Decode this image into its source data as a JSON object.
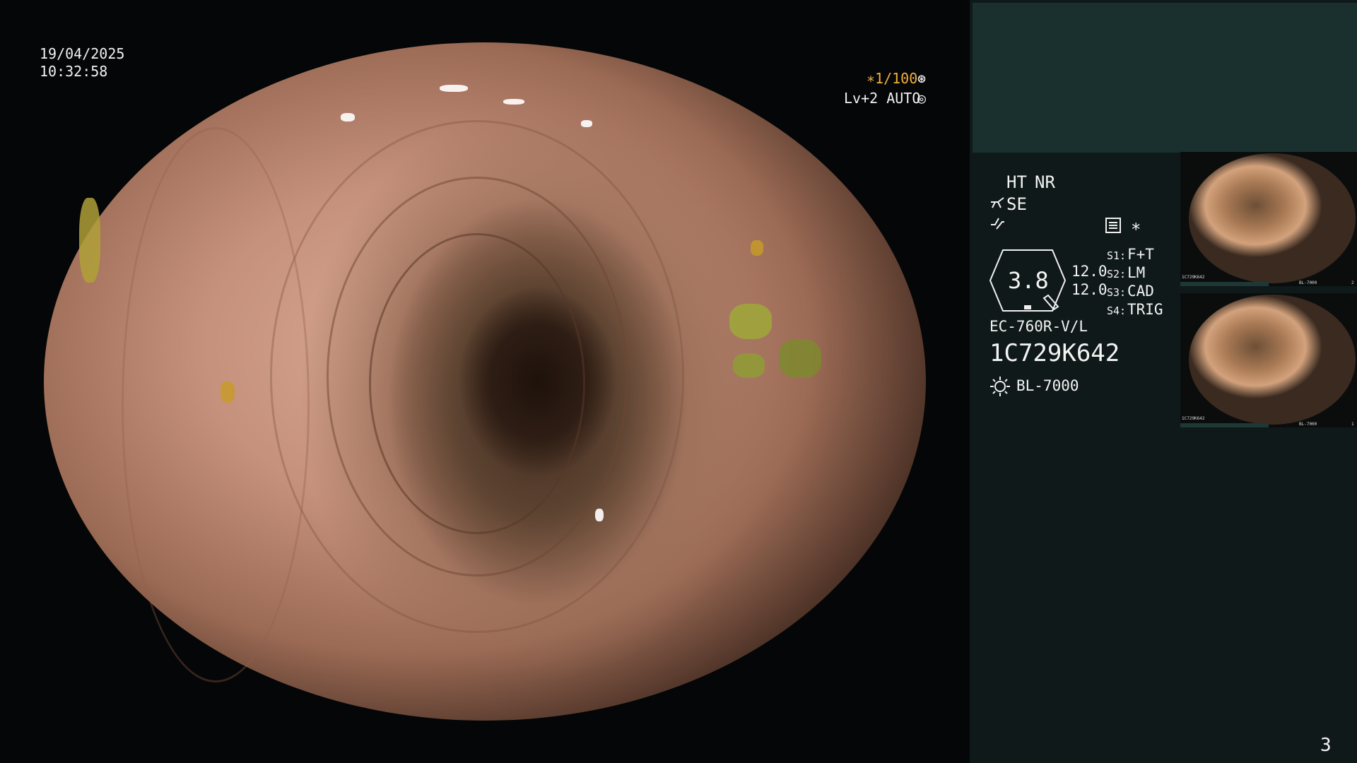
{
  "datetime": {
    "date": "19/04/2025",
    "time": "10:32:58"
  },
  "overlay": {
    "shutter": "∗1/100",
    "shutter_icon": "⊛",
    "level": "Lv+2 AUTO",
    "level_icon": "◎"
  },
  "settings": {
    "ht": "HT",
    "nr": "NR",
    "se": "SE",
    "zoom_value": "3.8",
    "diam_1": "12.0",
    "diam_2": "12.0",
    "s1_key": "S1:",
    "s1_val": "F+T",
    "s2_key": "S2:",
    "s2_val": "LM",
    "s3_key": "S3:",
    "s3_val": "CAD",
    "s4_key": "S4:",
    "s4_val": "TRIG",
    "asterisk": "∗"
  },
  "scope": {
    "model": "EC-760R-V/L",
    "serial": "1C729K642",
    "light_source": "BL-7000"
  },
  "thumbnails": [
    {
      "index": "2",
      "serial": "1C729K642",
      "light": "BL-7000"
    },
    {
      "index": "1",
      "serial": "1C729K642",
      "light": "BL-7000"
    }
  ],
  "page_number": "3",
  "icons": {
    "filter": "scissors-filter-icon",
    "pulse": "pulse-icon",
    "memory": "memory-icon",
    "light": "light-source-icon"
  },
  "colors": {
    "panel_bg": "#0f1919",
    "panel_top": "#1a302e",
    "accent": "#f0b040"
  }
}
